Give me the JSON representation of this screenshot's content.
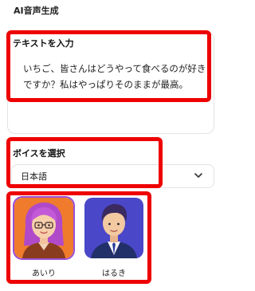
{
  "section": {
    "title": "AI音声生成"
  },
  "text_input": {
    "label": "テキストを入力",
    "value_line1": "いちご、皆さんはどうやって食べるのが好き",
    "value_line2": "ですか？私はやっぱりそのままが最高。"
  },
  "voice": {
    "label": "ボイスを選択",
    "language_selected": "日本語",
    "avatars": [
      {
        "name": "あいり",
        "selected": true
      },
      {
        "name": "はるき",
        "selected": false
      }
    ]
  },
  "colors": {
    "highlight": "#ee0000",
    "selected_border": "#9b4fd6",
    "airi_bg": "#f07b2c",
    "haruki_bg": "#4a47c8"
  }
}
